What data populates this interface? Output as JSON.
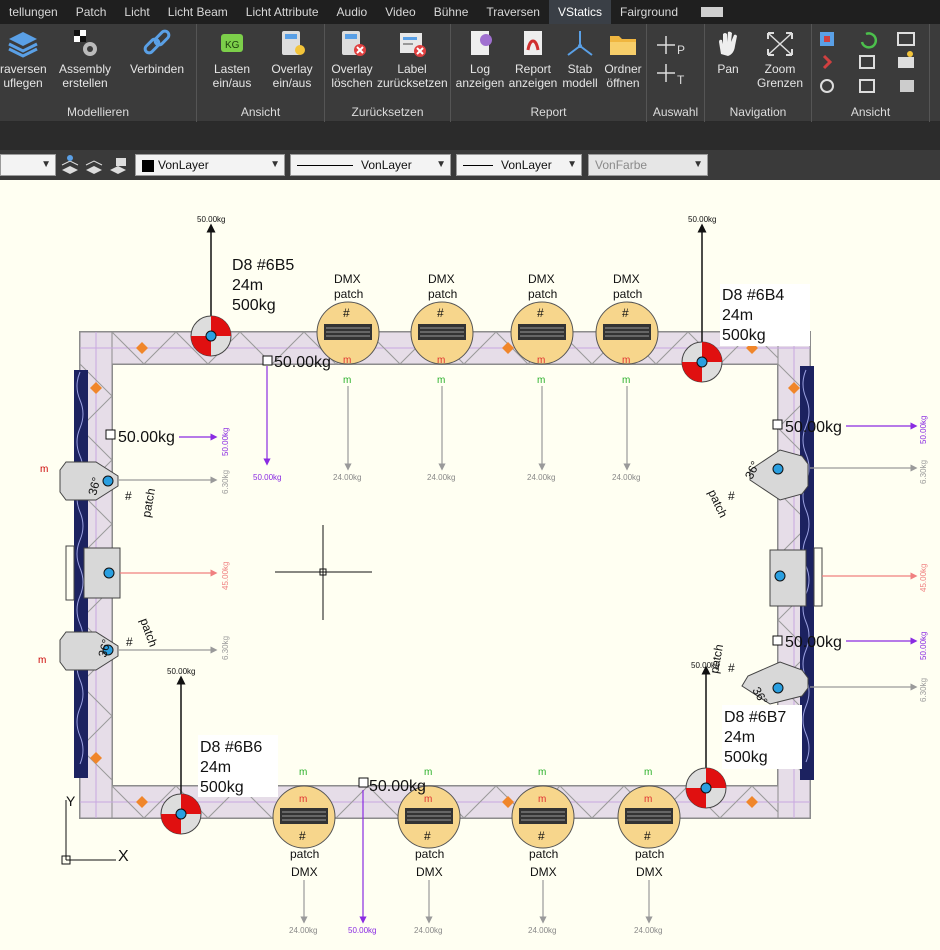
{
  "tabs": [
    "tellungen",
    "Patch",
    "Licht",
    "Licht Beam",
    "Licht Attribute",
    "Audio",
    "Video",
    "Bühne",
    "Traversen",
    "VStatics",
    "Fairground"
  ],
  "active_tab": "VStatics",
  "ribbon": {
    "groups": {
      "modellieren": "Modellieren",
      "ansicht1": "Ansicht",
      "zuruecksetzen": "Zurücksetzen",
      "report": "Report",
      "auswahl": "Auswahl",
      "navigation": "Navigation",
      "ansicht2": "Ansicht"
    },
    "buttons": {
      "traversen": "raversen\nuflegen",
      "assembly": "Assembly\nerstellen",
      "verbinden": "Verbinden",
      "lasten": "Lasten\nein/aus",
      "overlay": "Overlay\nein/aus",
      "overlay_loeschen": "Overlay\nlöschen",
      "label_reset": "Label\nzurücksetzen",
      "log": "Log\nanzeigen",
      "report": "Report\nanzeigen",
      "stab": "Stab\nmodell",
      "ordner": "Ordner\nöffnen",
      "pan": "Pan",
      "zoom": "Zoom\nGrenzen"
    }
  },
  "properties": {
    "color": "VonLayer",
    "linetype": "VonLayer",
    "lineweight": "VonLayer",
    "plotstyle": "VonFarbe"
  },
  "drawing": {
    "motors": {
      "m6B5": {
        "name": "D8  #6B5",
        "length": "24m",
        "load": "500kg"
      },
      "m6B4": {
        "name": "D8  #6B4",
        "length": "24m",
        "load": "500kg"
      },
      "m6B6": {
        "name": "D8  #6B6",
        "length": "24m",
        "load": "500kg"
      },
      "m6B7": {
        "name": "D8  #6B7",
        "length": "24m",
        "load": "500kg"
      }
    },
    "fixture_label_dmx": "DMX",
    "fixture_label_patch": "patch",
    "fixture_hash": "#",
    "fixture_m": "m",
    "side_fixture_label": "36°",
    "reaction_small": "50.00kg",
    "point_load": "50.00kg",
    "fixture_load": "24.00kg",
    "side_load": "6.30kg",
    "center_load": "45.00kg",
    "ucs_x": "X",
    "ucs_y": "Y"
  }
}
